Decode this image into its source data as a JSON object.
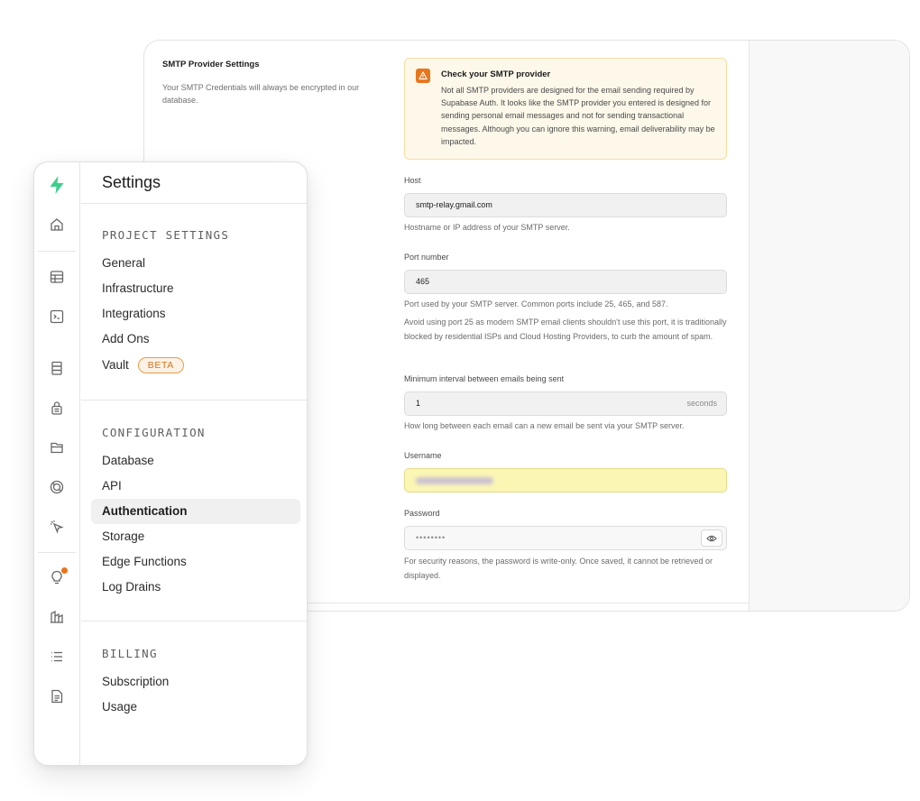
{
  "smtp": {
    "section_title": "SMTP Provider Settings",
    "section_desc": "Your SMTP Credentials will always be encrypted in our database.",
    "warning": {
      "title": "Check your SMTP provider",
      "body": "Not all SMTP providers are designed for the email sending required by Supabase Auth. It looks like the SMTP provider you entered is designed for sending personal email messages and not for sending transactional messages. Although you can ignore this warning, email deliverability may be impacted."
    },
    "host": {
      "label": "Host",
      "value": "smtp-relay.gmail.com",
      "help": "Hostname or IP address of your SMTP server."
    },
    "port": {
      "label": "Port number",
      "value": "465",
      "help1": "Port used by your SMTP server. Common ports include 25, 465, and 587.",
      "help2": "Avoid using port 25 as modern SMTP email clients shouldn't use this port, it is traditionally blocked by residential ISPs and Cloud Hosting Providers, to curb the amount of spam."
    },
    "interval": {
      "label": "Minimum interval between emails being sent",
      "value": "1",
      "suffix": "seconds",
      "help": "How long between each email can a new email be sent via your SMTP server."
    },
    "username": {
      "label": "Username"
    },
    "password": {
      "label": "Password",
      "value": "••••••••",
      "help": "For security reasons, the password is write-only. Once saved, it cannot be retrieved or displayed."
    }
  },
  "rail": {
    "icons": [
      "supabase-logo-icon",
      "home-icon",
      "table-editor-icon",
      "sql-editor-icon",
      "database-icon",
      "auth-icon",
      "storage-icon",
      "realtime-icon",
      "edge-functions-icon",
      "advisors-icon",
      "reports-icon",
      "logs-icon",
      "docs-icon"
    ],
    "colors": {
      "brand": "#3ecf8e",
      "notify": "#e8761c"
    }
  },
  "menu": {
    "title": "Settings",
    "project_heading": "PROJECT SETTINGS",
    "project_items": [
      "General",
      "Infrastructure",
      "Integrations",
      "Add Ons",
      "Vault"
    ],
    "vault_badge": "BETA",
    "config_heading": "CONFIGURATION",
    "config_items": [
      "Database",
      "API",
      "Authentication",
      "Storage",
      "Edge Functions",
      "Log Drains"
    ],
    "active_item": "Authentication",
    "billing_heading": "BILLING",
    "billing_items": [
      "Subscription",
      "Usage"
    ]
  }
}
